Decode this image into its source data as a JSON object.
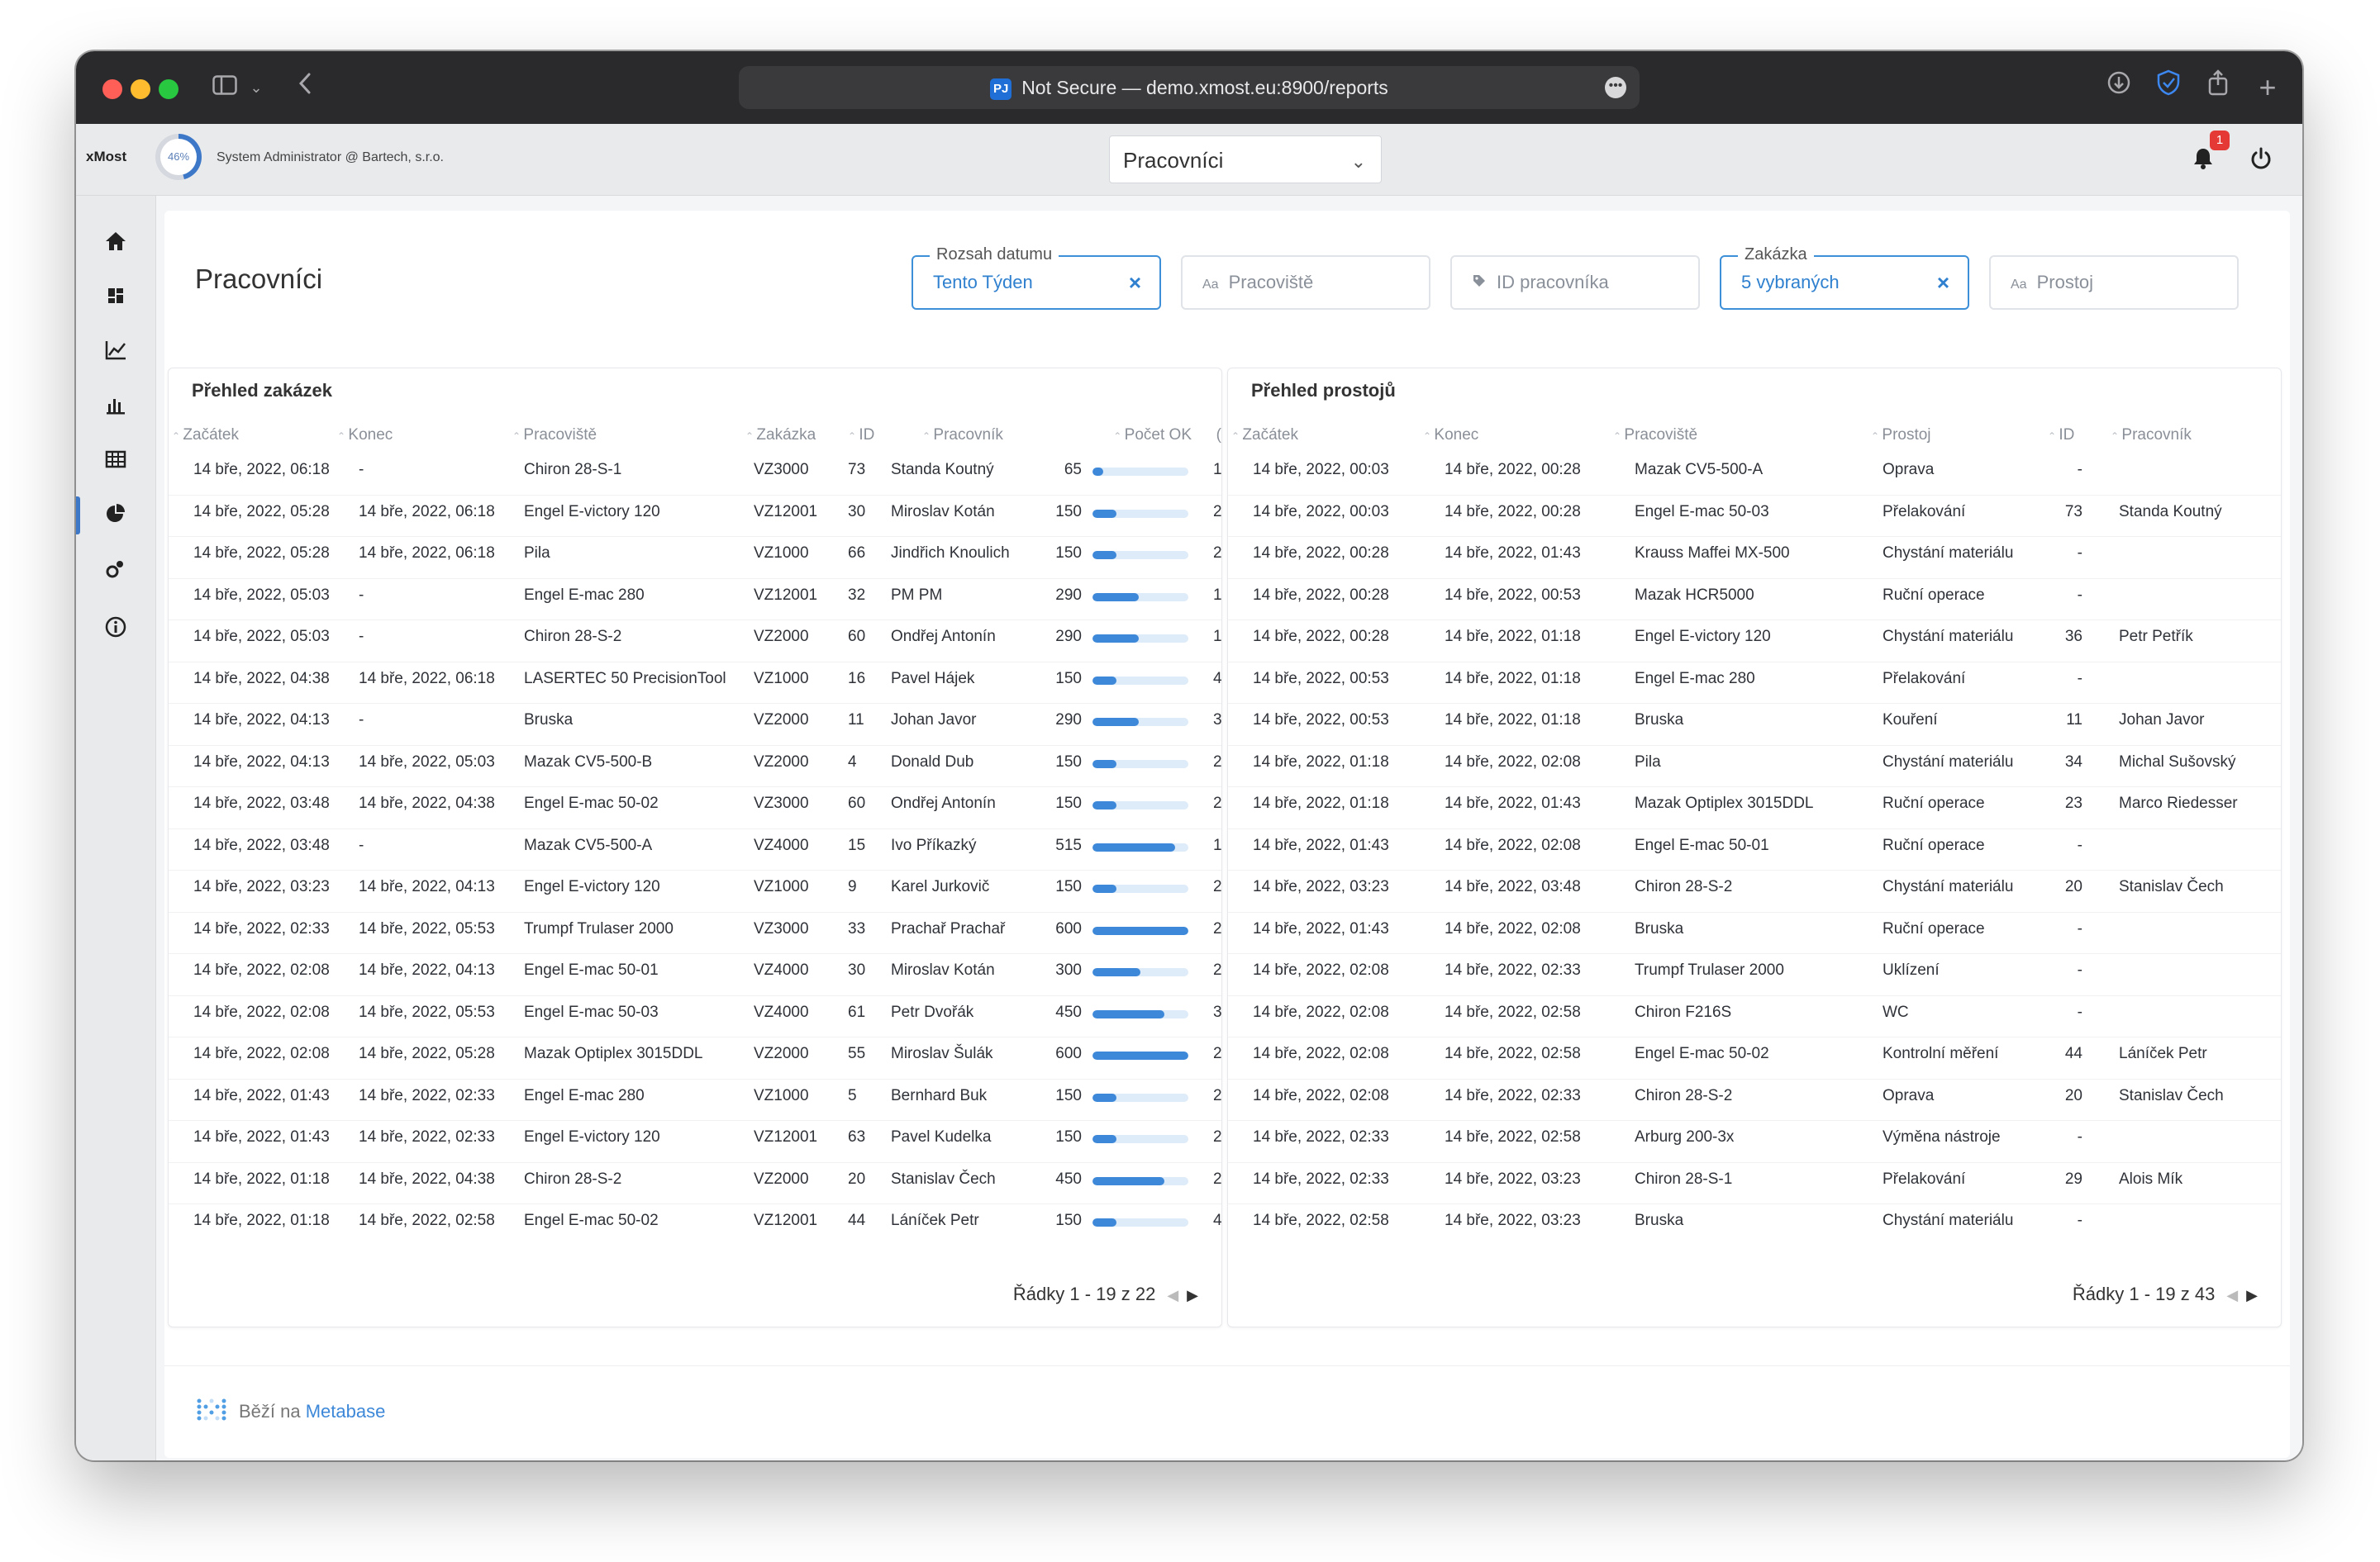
{
  "browser": {
    "url": "Not Secure — demo.xmost.eu:8900/reports",
    "site_badge": "PJ"
  },
  "header": {
    "brand": "xMost",
    "progress_label": "46%",
    "progress_value": 0.46,
    "user": "System Administrator @ Bartech, s.r.o.",
    "dashboard_select": "Pracovníci",
    "notification_count": "1"
  },
  "page": {
    "title": "Pracovníci",
    "filters": [
      {
        "label": "Rozsah datumu",
        "value": "Tento Týden",
        "active": true
      },
      {
        "label": "",
        "placeholder": "Pracoviště",
        "icon": "Aa"
      },
      {
        "label": "",
        "placeholder": "ID pracovníka",
        "icon": "tag-icon"
      },
      {
        "label": "Zakázka",
        "value": "5 vybraných",
        "active": true
      },
      {
        "label": "",
        "placeholder": "Prostoj",
        "icon": "Aa"
      }
    ]
  },
  "orders": {
    "title": "Přehled zakázek",
    "columns": [
      "Začátek",
      "Konec",
      "Pracoviště",
      "Zakázka",
      "ID",
      "Pracovník",
      "Počet OK",
      "("
    ],
    "rows": [
      [
        "14 bře, 2022, 06:18",
        "-",
        "Chiron 28-S-1",
        "VZ3000",
        "73",
        "Standa Koutný",
        "65",
        "1"
      ],
      [
        "14 bře, 2022, 05:28",
        "14 bře, 2022, 06:18",
        "Engel E-victory 120",
        "VZ12001",
        "30",
        "Miroslav Kotán",
        "150",
        "2"
      ],
      [
        "14 bře, 2022, 05:28",
        "14 bře, 2022, 06:18",
        "Pila",
        "VZ1000",
        "66",
        "Jindřich Knoulich",
        "150",
        "2"
      ],
      [
        "14 bře, 2022, 05:03",
        "-",
        "Engel E-mac 280",
        "VZ12001",
        "32",
        "PM PM",
        "290",
        "1"
      ],
      [
        "14 bře, 2022, 05:03",
        "-",
        "Chiron 28-S-2",
        "VZ2000",
        "60",
        "Ondřej Antonín",
        "290",
        "1"
      ],
      [
        "14 bře, 2022, 04:38",
        "14 bře, 2022, 06:18",
        "LASERTEC 50 PrecisionTool",
        "VZ1000",
        "16",
        "Pavel Hájek",
        "150",
        "4"
      ],
      [
        "14 bře, 2022, 04:13",
        "-",
        "Bruska",
        "VZ2000",
        "11",
        "Johan Javor",
        "290",
        "3"
      ],
      [
        "14 bře, 2022, 04:13",
        "14 bře, 2022, 05:03",
        "Mazak CV5-500-B",
        "VZ2000",
        "4",
        "Donald Dub",
        "150",
        "2"
      ],
      [
        "14 bře, 2022, 03:48",
        "14 bře, 2022, 04:38",
        "Engel E-mac 50-02",
        "VZ3000",
        "60",
        "Ondřej Antonín",
        "150",
        "2"
      ],
      [
        "14 bře, 2022, 03:48",
        "-",
        "Mazak CV5-500-A",
        "VZ4000",
        "15",
        "Ivo Příkazký",
        "515",
        "1"
      ],
      [
        "14 bře, 2022, 03:23",
        "14 bře, 2022, 04:13",
        "Engel E-victory 120",
        "VZ1000",
        "9",
        "Karel Jurkovič",
        "150",
        "2"
      ],
      [
        "14 bře, 2022, 02:33",
        "14 bře, 2022, 05:53",
        "Trumpf Trulaser 2000",
        "VZ3000",
        "33",
        "Prachař Prachař",
        "600",
        "2"
      ],
      [
        "14 bře, 2022, 02:08",
        "14 bře, 2022, 04:13",
        "Engel E-mac 50-01",
        "VZ4000",
        "30",
        "Miroslav Kotán",
        "300",
        "2"
      ],
      [
        "14 bře, 2022, 02:08",
        "14 bře, 2022, 05:53",
        "Engel E-mac 50-03",
        "VZ4000",
        "61",
        "Petr Dvořák",
        "450",
        "3"
      ],
      [
        "14 bře, 2022, 02:08",
        "14 bře, 2022, 05:28",
        "Mazak Optiplex 3015DDL",
        "VZ2000",
        "55",
        "Miroslav Šulák",
        "600",
        "2"
      ],
      [
        "14 bře, 2022, 01:43",
        "14 bře, 2022, 02:33",
        "Engel E-mac 280",
        "VZ1000",
        "5",
        "Bernhard Buk",
        "150",
        "2"
      ],
      [
        "14 bře, 2022, 01:43",
        "14 bře, 2022, 02:33",
        "Engel E-victory 120",
        "VZ12001",
        "63",
        "Pavel Kudelka",
        "150",
        "2"
      ],
      [
        "14 bře, 2022, 01:18",
        "14 bře, 2022, 04:38",
        "Chiron 28-S-2",
        "VZ2000",
        "20",
        "Stanislav Čech",
        "450",
        "2"
      ],
      [
        "14 bře, 2022, 01:18",
        "14 bře, 2022, 02:58",
        "Engel E-mac 50-02",
        "VZ12001",
        "44",
        "Láníček Petr",
        "150",
        "4"
      ]
    ],
    "ok_max": 600,
    "pager": "Řádky 1 - 19 z 22"
  },
  "downtimes": {
    "title": "Přehled prostojů",
    "columns": [
      "Začátek",
      "Konec",
      "Pracoviště",
      "Prostoj",
      "ID",
      "Pracovník"
    ],
    "rows": [
      [
        "14 bře, 2022, 00:03",
        "14 bře, 2022, 00:28",
        "Mazak CV5-500-A",
        "Oprava",
        "-",
        ""
      ],
      [
        "14 bře, 2022, 00:03",
        "14 bře, 2022, 00:28",
        "Engel E-mac 50-03",
        "Přelakování",
        "73",
        "Standa Koutný"
      ],
      [
        "14 bře, 2022, 00:28",
        "14 bře, 2022, 01:43",
        "Krauss Maffei MX-500",
        "Chystání materiálu",
        "-",
        ""
      ],
      [
        "14 bře, 2022, 00:28",
        "14 bře, 2022, 00:53",
        "Mazak HCR5000",
        "Ruční operace",
        "-",
        ""
      ],
      [
        "14 bře, 2022, 00:28",
        "14 bře, 2022, 01:18",
        "Engel E-victory 120",
        "Chystání materiálu",
        "36",
        "Petr Petřík"
      ],
      [
        "14 bře, 2022, 00:53",
        "14 bře, 2022, 01:18",
        "Engel E-mac 280",
        "Přelakování",
        "-",
        ""
      ],
      [
        "14 bře, 2022, 00:53",
        "14 bře, 2022, 01:18",
        "Bruska",
        "Kouření",
        "11",
        "Johan Javor"
      ],
      [
        "14 bře, 2022, 01:18",
        "14 bře, 2022, 02:08",
        "Pila",
        "Chystání materiálu",
        "34",
        "Michal Sušovský"
      ],
      [
        "14 bře, 2022, 01:18",
        "14 bře, 2022, 01:43",
        "Mazak Optiplex 3015DDL",
        "Ruční operace",
        "23",
        "Marco Riedesser"
      ],
      [
        "14 bře, 2022, 01:43",
        "14 bře, 2022, 02:08",
        "Engel E-mac 50-01",
        "Ruční operace",
        "-",
        ""
      ],
      [
        "14 bře, 2022, 03:23",
        "14 bře, 2022, 03:48",
        "Chiron 28-S-2",
        "Chystání materiálu",
        "20",
        "Stanislav Čech"
      ],
      [
        "14 bře, 2022, 01:43",
        "14 bře, 2022, 02:08",
        "Bruska",
        "Ruční operace",
        "-",
        ""
      ],
      [
        "14 bře, 2022, 02:08",
        "14 bře, 2022, 02:33",
        "Trumpf Trulaser 2000",
        "Uklízení",
        "-",
        ""
      ],
      [
        "14 bře, 2022, 02:08",
        "14 bře, 2022, 02:58",
        "Chiron F216S",
        "WC",
        "-",
        ""
      ],
      [
        "14 bře, 2022, 02:08",
        "14 bře, 2022, 02:58",
        "Engel E-mac 50-02",
        "Kontrolní měření",
        "44",
        "Láníček Petr"
      ],
      [
        "14 bře, 2022, 02:08",
        "14 bře, 2022, 02:33",
        "Chiron 28-S-2",
        "Oprava",
        "20",
        "Stanislav Čech"
      ],
      [
        "14 bře, 2022, 02:33",
        "14 bře, 2022, 02:58",
        "Arburg 200-3x",
        "Výměna nástroje",
        "-",
        ""
      ],
      [
        "14 bře, 2022, 02:33",
        "14 bře, 2022, 03:23",
        "Chiron 28-S-1",
        "Přelakování",
        "29",
        "Alois Mík"
      ],
      [
        "14 bře, 2022, 02:58",
        "14 bře, 2022, 03:23",
        "Bruska",
        "Chystání materiálu",
        "-",
        ""
      ]
    ],
    "pager": "Řádky 1 - 19 z 43"
  },
  "footer": {
    "prefix": "Běží na",
    "link": "Metabase"
  },
  "colors": {
    "accent": "#3d88d8",
    "bar_track": "#deebf8",
    "notification": "#e53935"
  }
}
